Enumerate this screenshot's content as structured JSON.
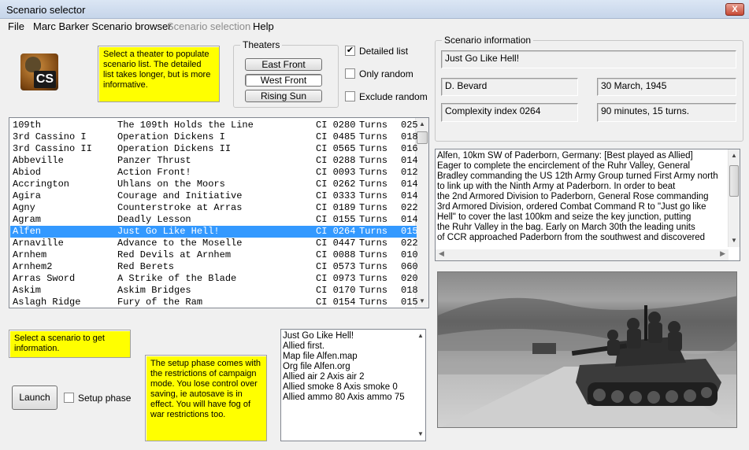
{
  "window": {
    "title": "Scenario selector",
    "close_glyph": "X"
  },
  "menu": [
    "File",
    "Marc Barker Scenario browser",
    "Scenario selection",
    "Help"
  ],
  "logo_text": "CS",
  "notes": {
    "theater_hint": "Select a theater to populate scenario list. The detailed list takes longer, but is more informative.",
    "scenario_hint": "Select a scenario to get information.",
    "setup_hint": "The setup phase comes with the restrictions of campaign mode. You lose control over saving, ie autosave is in effect. You will have fog of war restrictions too."
  },
  "theaters": {
    "label": "Theaters",
    "buttons": [
      "East Front",
      "West Front",
      "Rising Sun"
    ],
    "selected": "West Front"
  },
  "options": {
    "detailed_list": {
      "label": "Detailed list",
      "checked": true
    },
    "only_random": {
      "label": "Only random",
      "checked": false
    },
    "exclude_random": {
      "label": "Exclude random",
      "checked": false
    }
  },
  "scenario_list": [
    [
      "109th",
      "The 109th Holds the Line",
      "CI 0280",
      "Turns",
      "025"
    ],
    [
      "3rd Cassino I",
      "Operation Dickens I",
      "CI 0485",
      "Turns",
      "018"
    ],
    [
      "3rd Cassino II",
      "Operation Dickens II",
      "CI 0565",
      "Turns",
      "016"
    ],
    [
      "Abbeville",
      "Panzer Thrust",
      "CI 0288",
      "Turns",
      "014"
    ],
    [
      "Abiod",
      "Action Front!",
      "CI 0093",
      "Turns",
      "012"
    ],
    [
      "Accrington",
      "Uhlans on the Moors",
      "CI 0262",
      "Turns",
      "014"
    ],
    [
      "Agira",
      "Courage and Initiative",
      "CI 0333",
      "Turns",
      "014"
    ],
    [
      "Agny",
      "Counterstroke at Arras",
      "CI 0189",
      "Turns",
      "022"
    ],
    [
      "Agram",
      "Deadly Lesson",
      "CI 0155",
      "Turns",
      "014"
    ],
    [
      "Alfen",
      "Just Go Like Hell!",
      "CI 0264",
      "Turns",
      "015"
    ],
    [
      "Arnaville",
      "Advance to the Moselle",
      "CI 0447",
      "Turns",
      "022"
    ],
    [
      "Arnhem",
      "Red Devils at Arnhem",
      "CI 0088",
      "Turns",
      "010"
    ],
    [
      "Arnhem2",
      "Red Berets",
      "CI 0573",
      "Turns",
      "060"
    ],
    [
      "Arras Sword",
      "A Strike of the Blade",
      "CI 0973",
      "Turns",
      "020"
    ],
    [
      "Askim",
      "Askim Bridges",
      "CI 0170",
      "Turns",
      "018"
    ],
    [
      "Aslagh Ridge",
      "Fury of the Ram",
      "CI 0154",
      "Turns",
      "015"
    ]
  ],
  "selected_index": 9,
  "launch_label": "Launch",
  "setup_phase": {
    "label": "Setup phase",
    "checked": false
  },
  "scenario_file_info": [
    "Just Go Like Hell!",
    "Allied first.",
    "Map file Alfen.map",
    "Org file Alfen.org",
    "Allied air 2 Axis air 2",
    "Allied smoke 8 Axis smoke 0",
    "Allied ammo 80 Axis ammo 75"
  ],
  "scenario_info": {
    "label": "Scenario information",
    "title": "Just Go Like Hell!",
    "author": "D. Bevard",
    "date": "30 March, 1945",
    "complexity": "Complexity index 0264",
    "duration": "90 minutes, 15 turns."
  },
  "description": [
    "Alfen, 10km SW of Paderborn, Germany: [Best played as Allied]",
    "Eager to complete the encirclement of the Ruhr Valley, General",
    "Bradley commanding the US 12th Army Group turned First Army north",
    "to link up with the Ninth Army at Paderborn. In order to beat",
    "the 2nd Armored Division to Paderborn, General Rose commanding",
    "3rd Armored Division, ordered Combat Command R to \"Just go like",
    "Hell\" to cover the last 100km and seize the key junction, putting",
    "the Ruhr Valley in the bag. Early on March 30th the leading units",
    "of CCR approached Paderborn from the southwest and discovered"
  ],
  "icons": {
    "close": "close-icon",
    "scroll_up": "up-arrow-icon",
    "scroll_down": "down-arrow-icon",
    "scroll_left": "left-arrow-icon",
    "scroll_right": "right-arrow-icon",
    "checkmark": "checkmark-icon"
  }
}
